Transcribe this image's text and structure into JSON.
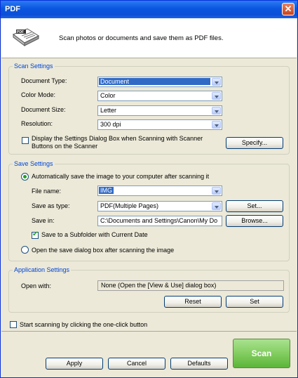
{
  "window": {
    "title": "PDF",
    "close_label": "✕"
  },
  "header": {
    "description": "Scan photos or documents and save them as PDF files."
  },
  "scan_settings": {
    "title": "Scan Settings",
    "document_type": {
      "label": "Document Type:",
      "value": "Document"
    },
    "color_mode": {
      "label": "Color Mode:",
      "value": "Color"
    },
    "document_size": {
      "label": "Document Size:",
      "value": "Letter"
    },
    "resolution": {
      "label": "Resolution:",
      "value": "300 dpi"
    },
    "display_dialog": {
      "label_line1": "Display the Settings Dialog Box when Scanning with Scanner",
      "label_line2": "Buttons on the Scanner",
      "checked": false
    },
    "specify_label": "Specify..."
  },
  "save_settings": {
    "title": "Save Settings",
    "auto_save_label": "Automatically save the image to your computer after scanning it",
    "auto_save_selected": true,
    "file_name": {
      "label": "File name:",
      "value": "IMG"
    },
    "save_as_type": {
      "label": "Save as  type:",
      "value": "PDF(Multiple Pages)"
    },
    "set_label": "Set...",
    "save_in": {
      "label": "Save in:",
      "value": "C:\\Documents and Settings\\Canon\\My Do"
    },
    "browse_label": "Browse...",
    "subfolder": {
      "label": "Save to a Subfolder with Current Date",
      "checked": true
    },
    "open_dialog_label": "Open the save dialog box after scanning the image",
    "open_dialog_selected": false
  },
  "application_settings": {
    "title": "Application Settings",
    "open_with_label": "Open with:",
    "open_with_value": "None (Open the [View & Use] dialog box)",
    "reset_label": "Reset",
    "set_label": "Set"
  },
  "one_click": {
    "label": "Start scanning by clicking the one-click button",
    "checked": false
  },
  "footer": {
    "apply_label": "Apply",
    "cancel_label": "Cancel",
    "defaults_label": "Defaults",
    "scan_label": "Scan"
  },
  "colors": {
    "title_bar": "#0a56e0",
    "group_title": "#0046d5",
    "scan_button": "#7fcb5c"
  }
}
